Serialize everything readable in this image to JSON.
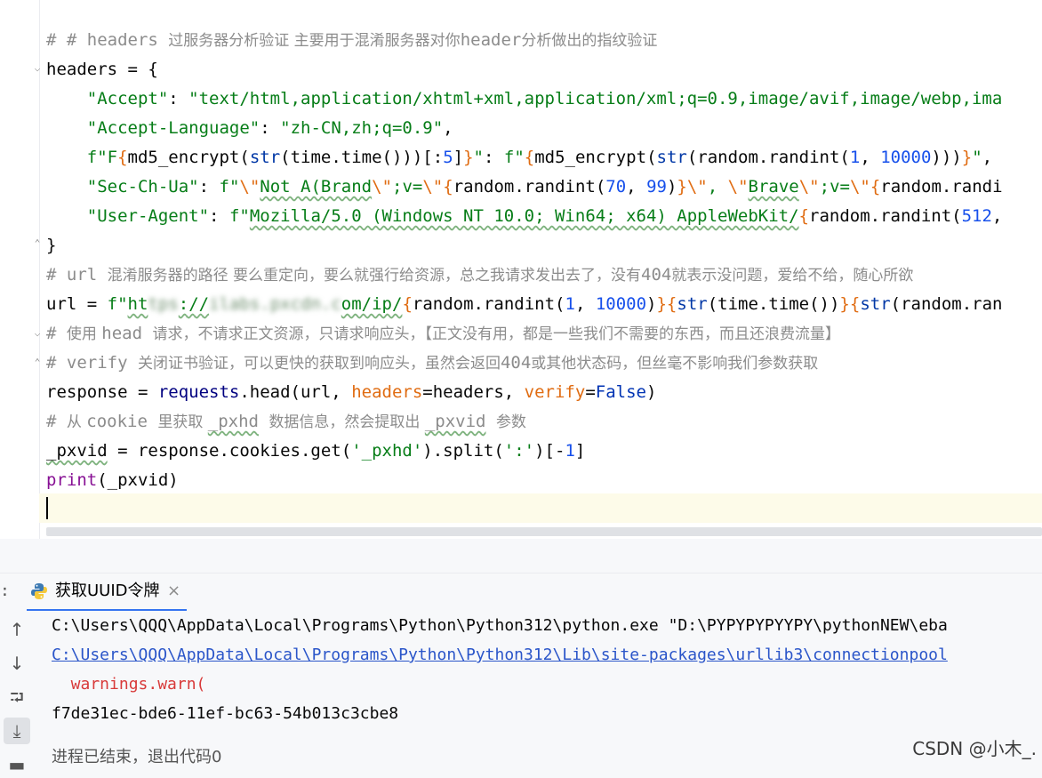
{
  "editor": {
    "lines": [
      {
        "segments": [
          {
            "t": "# # headers ",
            "c": "c"
          },
          {
            "t": "过服务器分析验证 主要用于混淆服务器对你",
            "c": "c cn"
          },
          {
            "t": "header",
            "c": "c"
          },
          {
            "t": "分析做出的指纹验证",
            "c": "c cn"
          }
        ]
      },
      {
        "segments": [
          {
            "t": "headers = {",
            "c": ""
          }
        ]
      },
      {
        "segments": [
          {
            "t": "    ",
            "c": ""
          },
          {
            "t": "\"Accept\"",
            "c": "s"
          },
          {
            "t": ": ",
            "c": ""
          },
          {
            "t": "\"text/html,application/xhtml+xml,application/xml;q=0.9,image/avif,image/webp,ima",
            "c": "s"
          }
        ]
      },
      {
        "segments": [
          {
            "t": "    ",
            "c": ""
          },
          {
            "t": "\"Accept-Language\"",
            "c": "s"
          },
          {
            "t": ": ",
            "c": ""
          },
          {
            "t": "\"zh-CN,zh;q=0.9\"",
            "c": "s"
          },
          {
            "t": ",",
            "c": ""
          }
        ]
      },
      {
        "segments": [
          {
            "t": "    ",
            "c": ""
          },
          {
            "t": "f\"F",
            "c": "s"
          },
          {
            "t": "{",
            "c": "o"
          },
          {
            "t": "md5_encrypt(",
            "c": ""
          },
          {
            "t": "str",
            "c": "g"
          },
          {
            "t": "(time.time()))[:",
            "c": ""
          },
          {
            "t": "5",
            "c": "n"
          },
          {
            "t": "]",
            "c": ""
          },
          {
            "t": "}",
            "c": "o"
          },
          {
            "t": "\"",
            "c": "s"
          },
          {
            "t": ": ",
            "c": ""
          },
          {
            "t": "f\"",
            "c": "s"
          },
          {
            "t": "{",
            "c": "o"
          },
          {
            "t": "md5_encrypt(",
            "c": ""
          },
          {
            "t": "str",
            "c": "g"
          },
          {
            "t": "(random.randint(",
            "c": ""
          },
          {
            "t": "1",
            "c": "n"
          },
          {
            "t": ", ",
            "c": ""
          },
          {
            "t": "10000",
            "c": "n"
          },
          {
            "t": ")))",
            "c": ""
          },
          {
            "t": "}",
            "c": "o"
          },
          {
            "t": "\"",
            "c": "s"
          },
          {
            "t": ",",
            "c": ""
          }
        ]
      },
      {
        "segments": [
          {
            "t": "    ",
            "c": ""
          },
          {
            "t": "\"Sec-Ch-Ua\"",
            "c": "s"
          },
          {
            "t": ": ",
            "c": ""
          },
          {
            "t": "f\"",
            "c": "s"
          },
          {
            "t": "\\\"",
            "c": "o"
          },
          {
            "t": "Not A(Brand",
            "c": "s u"
          },
          {
            "t": "\\\"",
            "c": "o"
          },
          {
            "t": ";v=",
            "c": "s"
          },
          {
            "t": "\\\"",
            "c": "o"
          },
          {
            "t": "{",
            "c": "o"
          },
          {
            "t": "random.randint(",
            "c": ""
          },
          {
            "t": "70",
            "c": "n"
          },
          {
            "t": ", ",
            "c": ""
          },
          {
            "t": "99",
            "c": "n"
          },
          {
            "t": ")",
            "c": ""
          },
          {
            "t": "}",
            "c": "o"
          },
          {
            "t": "\\\"",
            "c": "o"
          },
          {
            "t": ", ",
            "c": "s"
          },
          {
            "t": "\\\"",
            "c": "o"
          },
          {
            "t": "Brave",
            "c": "s u"
          },
          {
            "t": "\\\"",
            "c": "o"
          },
          {
            "t": ";v=",
            "c": "s"
          },
          {
            "t": "\\\"",
            "c": "o"
          },
          {
            "t": "{",
            "c": "o"
          },
          {
            "t": "random.randi",
            "c": ""
          }
        ]
      },
      {
        "segments": [
          {
            "t": "    ",
            "c": ""
          },
          {
            "t": "\"User-Agent\"",
            "c": "s"
          },
          {
            "t": ": ",
            "c": ""
          },
          {
            "t": "f\"",
            "c": "s"
          },
          {
            "t": "Mozilla/5.0 (Windows NT 10.0; Win64; x64) AppleWebKit/",
            "c": "s u"
          },
          {
            "t": "{",
            "c": "o"
          },
          {
            "t": "random.randint(",
            "c": ""
          },
          {
            "t": "512",
            "c": "n"
          },
          {
            "t": ",",
            "c": ""
          }
        ]
      },
      {
        "segments": [
          {
            "t": "}",
            "c": ""
          }
        ]
      },
      {
        "segments": [
          {
            "t": "# url ",
            "c": "c"
          },
          {
            "t": "混淆服务器的路径 要么重定向，要么就强行给资源，总之我请求发出去了，没有",
            "c": "c cn"
          },
          {
            "t": "404",
            "c": "c"
          },
          {
            "t": "就表示没问题，爱给不给，随心所欲",
            "c": "c cn"
          }
        ]
      },
      {
        "segments": [
          {
            "t": "url = ",
            "c": ""
          },
          {
            "t": "f\"",
            "c": "s"
          },
          {
            "t": "ht",
            "c": "s u"
          },
          {
            "t": "tps",
            "c": "s blur"
          },
          {
            "t": "://",
            "c": "s u"
          },
          {
            "t": "ilabs.pxcdn.c",
            "c": "s blur"
          },
          {
            "t": "om/ip/",
            "c": "s u"
          },
          {
            "t": "{",
            "c": "o"
          },
          {
            "t": "random.randint(",
            "c": ""
          },
          {
            "t": "1",
            "c": "n"
          },
          {
            "t": ", ",
            "c": ""
          },
          {
            "t": "10000",
            "c": "n"
          },
          {
            "t": ")",
            "c": ""
          },
          {
            "t": "}{",
            "c": "o"
          },
          {
            "t": "str",
            "c": "g"
          },
          {
            "t": "(time.time())",
            "c": ""
          },
          {
            "t": "}{",
            "c": "o"
          },
          {
            "t": "str",
            "c": "g"
          },
          {
            "t": "(random.ran",
            "c": ""
          }
        ]
      },
      {
        "segments": [
          {
            "t": "# ",
            "c": "c"
          },
          {
            "t": "使用 ",
            "c": "c cn"
          },
          {
            "t": "head ",
            "c": "c"
          },
          {
            "t": "请求，不请求正文资源，只请求响应头，【正文没有用，都是一些我们不需要的东西，而且还浪费流量】",
            "c": "c cn"
          }
        ]
      },
      {
        "segments": [
          {
            "t": "# verify ",
            "c": "c"
          },
          {
            "t": "关闭证书验证，可以更快的获取到响应头，虽然会返回",
            "c": "c cn"
          },
          {
            "t": "404",
            "c": "c"
          },
          {
            "t": "或其他状态码，但丝毫不影响我们参数获取",
            "c": "c cn"
          }
        ]
      },
      {
        "segments": [
          {
            "t": "response = ",
            "c": ""
          },
          {
            "t": "requests",
            "c": "b"
          },
          {
            "t": ".head(url, ",
            "c": ""
          },
          {
            "t": "headers",
            "c": "o"
          },
          {
            "t": "=headers, ",
            "c": ""
          },
          {
            "t": "verify",
            "c": "o"
          },
          {
            "t": "=",
            "c": ""
          },
          {
            "t": "False",
            "c": "k"
          },
          {
            "t": ")",
            "c": ""
          }
        ]
      },
      {
        "segments": [
          {
            "t": "# ",
            "c": "c"
          },
          {
            "t": "从 ",
            "c": "c cn"
          },
          {
            "t": "cookie ",
            "c": "c"
          },
          {
            "t": "里获取 ",
            "c": "c cn"
          },
          {
            "t": "_pxhd",
            "c": "c u"
          },
          {
            "t": " ",
            "c": "c"
          },
          {
            "t": "数据信息，然会提取出 ",
            "c": "c cn"
          },
          {
            "t": "_pxvid",
            "c": "c u"
          },
          {
            "t": " ",
            "c": "c"
          },
          {
            "t": "参数",
            "c": "c cn"
          }
        ]
      },
      {
        "segments": [
          {
            "t": "_pxvid",
            "c": "u"
          },
          {
            "t": " = response.cookies.get(",
            "c": ""
          },
          {
            "t": "'_pxhd'",
            "c": "s"
          },
          {
            "t": ").split(",
            "c": ""
          },
          {
            "t": "':'",
            "c": "s"
          },
          {
            "t": ")[-",
            "c": ""
          },
          {
            "t": "1",
            "c": "n"
          },
          {
            "t": "]",
            "c": ""
          }
        ]
      },
      {
        "segments": [
          {
            "t": "print",
            "c": "f"
          },
          {
            "t": "(_pxvid)",
            "c": ""
          }
        ]
      }
    ]
  },
  "run_tab": {
    "label": "获取UUID令牌",
    "close": "×",
    "colon": ":"
  },
  "sidebar": {
    "up": "↑",
    "down": "↓",
    "wrap": "⮒",
    "scroll_end": "⤓",
    "print": "▬"
  },
  "console": {
    "line1": "C:\\Users\\QQQ\\AppData\\Local\\Programs\\Python\\Python312\\python.exe \"D:\\PYPYPYPYYPY\\pythonNEW\\eba",
    "line2": "C:\\Users\\QQQ\\AppData\\Local\\Programs\\Python\\Python312\\Lib\\site-packages\\urllib3\\connectionpool",
    "line3": "  warnings.warn(",
    "line4": "f7de31ec-bde6-11ef-bc63-54b013c3cbe8",
    "line5": "进程已结束，退出代码0"
  },
  "watermark": "CSDN @小木_."
}
